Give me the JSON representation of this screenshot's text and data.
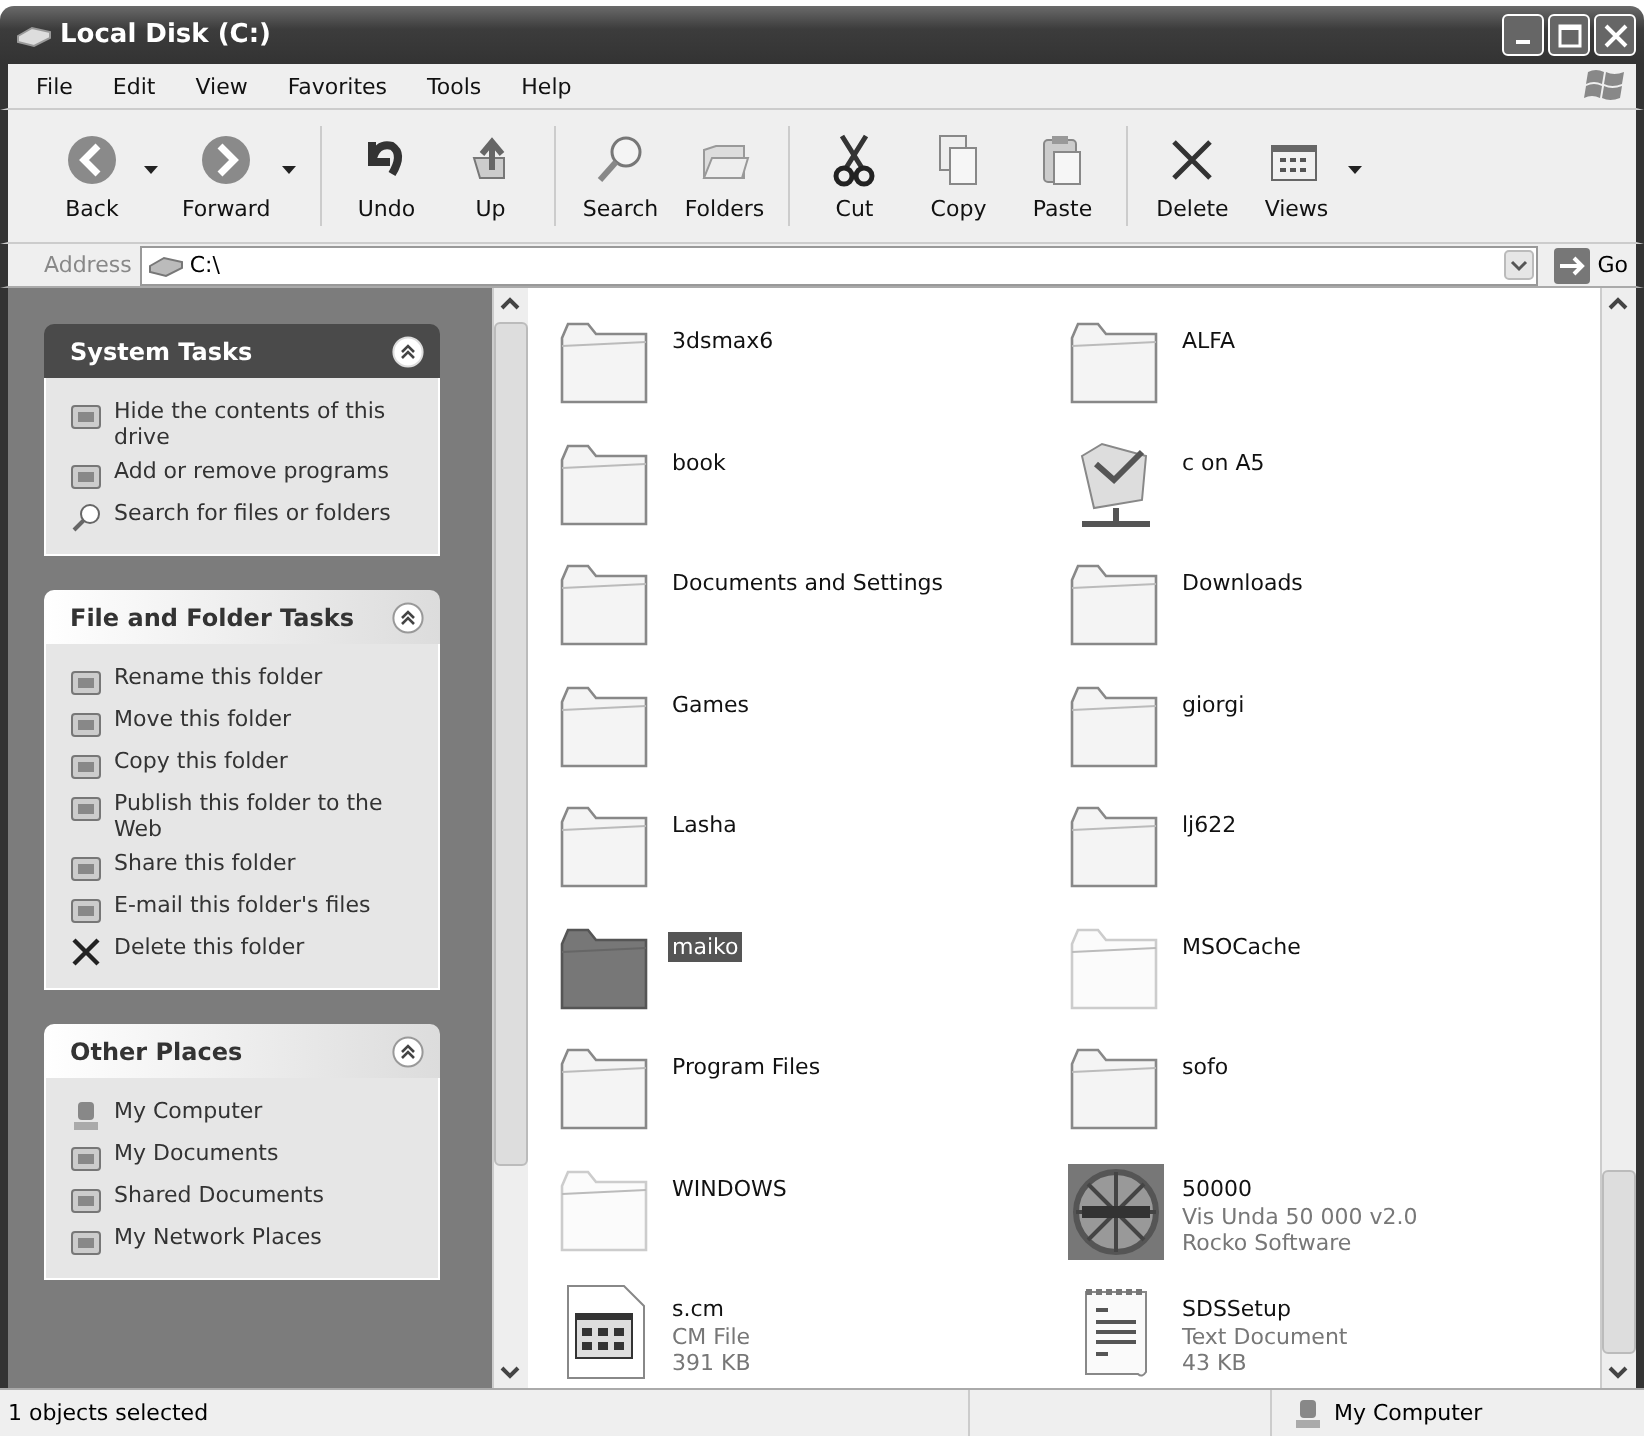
{
  "window": {
    "title": "Local Disk (C:)"
  },
  "menu": [
    "File",
    "Edit",
    "View",
    "Favorites",
    "Tools",
    "Help"
  ],
  "toolbar": [
    {
      "label": "Back",
      "dropdown": true
    },
    {
      "label": "Forward",
      "dropdown": true
    },
    {
      "label": "Undo",
      "dropdown": false
    },
    {
      "label": "Up",
      "dropdown": false
    },
    {
      "label": "Search",
      "dropdown": false
    },
    {
      "label": "Folders",
      "dropdown": false
    },
    {
      "label": "Cut",
      "dropdown": false
    },
    {
      "label": "Copy",
      "dropdown": false
    },
    {
      "label": "Paste",
      "dropdown": false
    },
    {
      "label": "Delete",
      "dropdown": false
    },
    {
      "label": "Views",
      "dropdown": true
    }
  ],
  "address": {
    "label": "Address",
    "value": "C:\\",
    "go": "Go"
  },
  "panels": [
    {
      "title": "System Tasks",
      "highlighted": true,
      "items": [
        "Hide the contents of this drive",
        "Add or remove programs",
        "Search for files or folders"
      ]
    },
    {
      "title": "File and Folder Tasks",
      "highlighted": false,
      "items": [
        "Rename this folder",
        "Move this folder",
        "Copy this folder",
        "Publish this folder to the Web",
        "Share this folder",
        "E-mail this folder's files",
        "Delete this folder"
      ]
    },
    {
      "title": "Other Places",
      "highlighted": false,
      "items": [
        "My Computer",
        "My Documents",
        "Shared Documents",
        "My Network Places"
      ]
    }
  ],
  "files": [
    {
      "name": "3dsmax6",
      "kind": "folder",
      "selected": false
    },
    {
      "name": "ALFA",
      "kind": "folder",
      "selected": false
    },
    {
      "name": "book",
      "kind": "folder",
      "selected": false
    },
    {
      "name": "c on A5",
      "kind": "network",
      "selected": false
    },
    {
      "name": "Documents and Settings",
      "kind": "folder",
      "selected": false
    },
    {
      "name": "Downloads",
      "kind": "folder",
      "selected": false
    },
    {
      "name": "Games",
      "kind": "folder",
      "selected": false
    },
    {
      "name": "giorgi",
      "kind": "folder",
      "selected": false
    },
    {
      "name": "Lasha",
      "kind": "folder",
      "selected": false
    },
    {
      "name": "lj622",
      "kind": "folder",
      "selected": false
    },
    {
      "name": "maiko",
      "kind": "folder",
      "selected": true
    },
    {
      "name": "MSOCache",
      "kind": "hidden",
      "selected": false
    },
    {
      "name": "Program Files",
      "kind": "folder",
      "selected": false
    },
    {
      "name": "sofo",
      "kind": "folder",
      "selected": false
    },
    {
      "name": "WINDOWS",
      "kind": "hidden",
      "selected": false
    },
    {
      "name": "50000",
      "kind": "app",
      "selected": false,
      "details": [
        "Vis Unda 50 000 v2.0",
        "Rocko Software"
      ]
    },
    {
      "name": "s.cm",
      "kind": "cmfile",
      "selected": false,
      "details": [
        "CM File",
        "391 KB"
      ]
    },
    {
      "name": "SDSSetup",
      "kind": "text",
      "selected": false,
      "details": [
        "Text Document",
        "43 KB"
      ]
    }
  ],
  "status_bar": {
    "text": "1 objects selected",
    "zone": "My Computer"
  }
}
